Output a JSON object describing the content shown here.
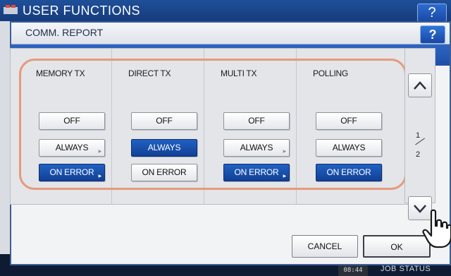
{
  "window": {
    "background_title": "USER FUNCTIONS",
    "help_label": "?"
  },
  "dialog": {
    "title": "COMM. REPORT",
    "help_label": "?"
  },
  "columns": [
    {
      "label": "MEMORY TX",
      "buttons": [
        {
          "label": "OFF",
          "selected": false,
          "has_submenu": false
        },
        {
          "label": "ALWAYS",
          "selected": false,
          "has_submenu": true
        },
        {
          "label": "ON ERROR",
          "selected": true,
          "has_submenu": true
        }
      ]
    },
    {
      "label": "DIRECT TX",
      "buttons": [
        {
          "label": "OFF",
          "selected": false,
          "has_submenu": false
        },
        {
          "label": "ALWAYS",
          "selected": true,
          "has_submenu": false
        },
        {
          "label": "ON ERROR",
          "selected": false,
          "has_submenu": false
        }
      ]
    },
    {
      "label": "MULTI TX",
      "buttons": [
        {
          "label": "OFF",
          "selected": false,
          "has_submenu": false
        },
        {
          "label": "ALWAYS",
          "selected": false,
          "has_submenu": true
        },
        {
          "label": "ON ERROR",
          "selected": true,
          "has_submenu": true
        }
      ]
    },
    {
      "label": "POLLING",
      "buttons": [
        {
          "label": "OFF",
          "selected": false,
          "has_submenu": false
        },
        {
          "label": "ALWAYS",
          "selected": false,
          "has_submenu": false
        },
        {
          "label": "ON ERROR",
          "selected": true,
          "has_submenu": false
        }
      ]
    }
  ],
  "pager": {
    "current": "1",
    "total": "2",
    "up_icon": "chevron-up-icon",
    "down_icon": "chevron-down-icon"
  },
  "actions": {
    "cancel_label": "CANCEL",
    "ok_label": "OK"
  },
  "status_bar": {
    "clock": "08:44",
    "job_status_label": "JOB STATUS"
  },
  "colors": {
    "selected_button": "#1a4fae",
    "highlight_outline": "#e59a7c",
    "title_band": "#2558b5"
  }
}
